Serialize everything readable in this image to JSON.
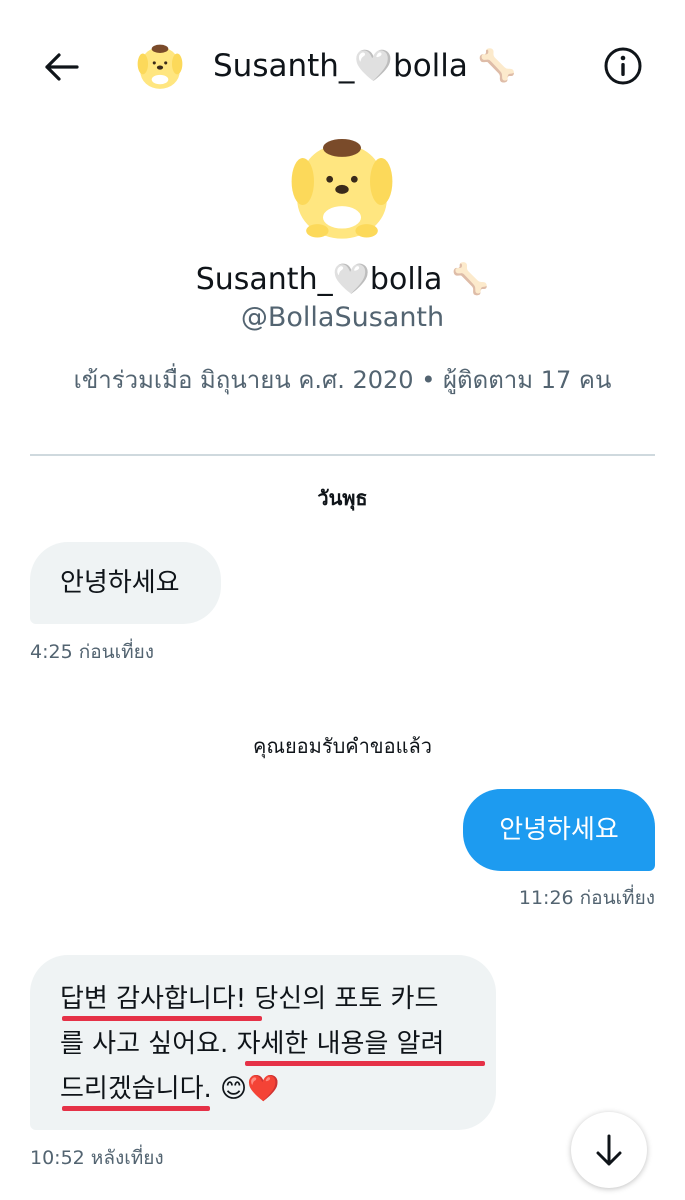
{
  "header": {
    "back_icon": "arrow-left-icon",
    "name": "Susanth_🤍bolla 🦴",
    "info_icon": "info-circle-icon"
  },
  "profile": {
    "name": "Susanth_🤍bolla 🦴",
    "handle": "@BollaSusanth",
    "meta": "เข้าร่วมเมื่อ มิถุนายน ค.ศ. 2020 • ผู้ติดตาม 17 คน"
  },
  "conversation": {
    "day_label": "วันพุธ",
    "messages": [
      {
        "direction": "incoming",
        "text": "안녕하세요",
        "time": "4:25 ก่อนเที่ยง"
      },
      {
        "direction": "outgoing",
        "text": "안녕하세요",
        "time": "11:26 ก่อนเที่ยง"
      },
      {
        "direction": "incoming",
        "lines": [
          "답변 감사합니다! 당신의 포토 카드",
          "를 사고 싶어요. 자세한 내용을 알려",
          "드리겠습니다. 😊❤️"
        ],
        "time": "10:52 หลังเที่ยง"
      }
    ],
    "system_note": "คุณยอมรับคำขอแล้ว"
  },
  "colors": {
    "accent": "#1d9bf0",
    "incoming_bubble": "#eff3f4",
    "secondary_text": "#536471",
    "underline": "#e53147"
  },
  "scroll_icon": "arrow-down-icon"
}
